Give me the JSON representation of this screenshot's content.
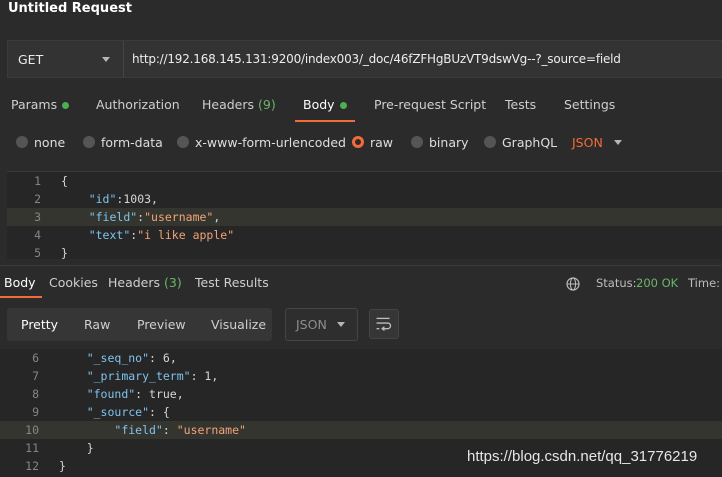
{
  "app": {
    "title": "Untitled Request"
  },
  "request": {
    "method": "GET",
    "url": "http://192.168.145.131:9200/index003/_doc/46fZFHgBUzVT9dswVg--?_source=field",
    "tabs": [
      {
        "label": "Params"
      },
      {
        "label": "Authorization"
      },
      {
        "label": "Headers",
        "count": "(9)"
      },
      {
        "label": "Body"
      },
      {
        "label": "Pre-request Script"
      },
      {
        "label": "Tests"
      },
      {
        "label": "Settings"
      }
    ],
    "body_types": [
      "none",
      "form-data",
      "x-www-form-urlencoded",
      "raw",
      "binary",
      "GraphQL"
    ],
    "selected_body_type": "raw",
    "format": "JSON",
    "body_lines": [
      {
        "num": "1",
        "parts": [
          {
            "t": "{",
            "c": "p"
          }
        ]
      },
      {
        "num": "2",
        "parts": [
          {
            "t": "    ",
            "c": "p"
          },
          {
            "t": "\"id\"",
            "c": "k"
          },
          {
            "t": ":",
            "c": "p"
          },
          {
            "t": "1003",
            "c": "n"
          },
          {
            "t": ",",
            "c": "p"
          }
        ]
      },
      {
        "num": "3",
        "parts": [
          {
            "t": "    ",
            "c": "p"
          },
          {
            "t": "\"field\"",
            "c": "k"
          },
          {
            "t": ":",
            "c": "p"
          },
          {
            "t": "\"username\"",
            "c": "s"
          },
          {
            "t": ",",
            "c": "p"
          }
        ]
      },
      {
        "num": "4",
        "parts": [
          {
            "t": "    ",
            "c": "p"
          },
          {
            "t": "\"text\"",
            "c": "k"
          },
          {
            "t": ":",
            "c": "p"
          },
          {
            "t": "\"i like apple\"",
            "c": "s"
          }
        ]
      },
      {
        "num": "5",
        "parts": [
          {
            "t": "}",
            "c": "p"
          }
        ]
      }
    ]
  },
  "response": {
    "tabs": [
      {
        "label": "Body"
      },
      {
        "label": "Cookies"
      },
      {
        "label": "Headers",
        "count": "(3)"
      },
      {
        "label": "Test Results"
      }
    ],
    "status_label": "Status:",
    "status_value": "200 OK",
    "time_label": "Time:",
    "view_modes": [
      "Pretty",
      "Raw",
      "Preview",
      "Visualize"
    ],
    "format": "JSON",
    "body_lines": [
      {
        "num": "6",
        "parts": [
          {
            "t": "    ",
            "c": "p"
          },
          {
            "t": "\"_seq_no\"",
            "c": "k"
          },
          {
            "t": ": ",
            "c": "p"
          },
          {
            "t": "6",
            "c": "n"
          },
          {
            "t": ",",
            "c": "p"
          }
        ]
      },
      {
        "num": "7",
        "parts": [
          {
            "t": "    ",
            "c": "p"
          },
          {
            "t": "\"_primary_term\"",
            "c": "k"
          },
          {
            "t": ": ",
            "c": "p"
          },
          {
            "t": "1",
            "c": "n"
          },
          {
            "t": ",",
            "c": "p"
          }
        ]
      },
      {
        "num": "8",
        "parts": [
          {
            "t": "    ",
            "c": "p"
          },
          {
            "t": "\"found\"",
            "c": "k"
          },
          {
            "t": ": ",
            "c": "p"
          },
          {
            "t": "true",
            "c": "n"
          },
          {
            "t": ",",
            "c": "p"
          }
        ]
      },
      {
        "num": "9",
        "parts": [
          {
            "t": "    ",
            "c": "p"
          },
          {
            "t": "\"_source\"",
            "c": "k"
          },
          {
            "t": ": {",
            "c": "p"
          }
        ]
      },
      {
        "num": "10",
        "parts": [
          {
            "t": "        ",
            "c": "p"
          },
          {
            "t": "\"field\"",
            "c": "k"
          },
          {
            "t": ": ",
            "c": "p"
          },
          {
            "t": "\"username\"",
            "c": "s"
          }
        ]
      },
      {
        "num": "11",
        "parts": [
          {
            "t": "    }",
            "c": "p"
          }
        ]
      },
      {
        "num": "12",
        "parts": [
          {
            "t": "}",
            "c": "p"
          }
        ]
      }
    ]
  },
  "watermark": "https://blog.csdn.net/qq_31776219",
  "colors": {
    "accent": "#f26b3a",
    "success": "#6bb56b",
    "key": "#7ec3ee",
    "string": "#f2a378"
  }
}
